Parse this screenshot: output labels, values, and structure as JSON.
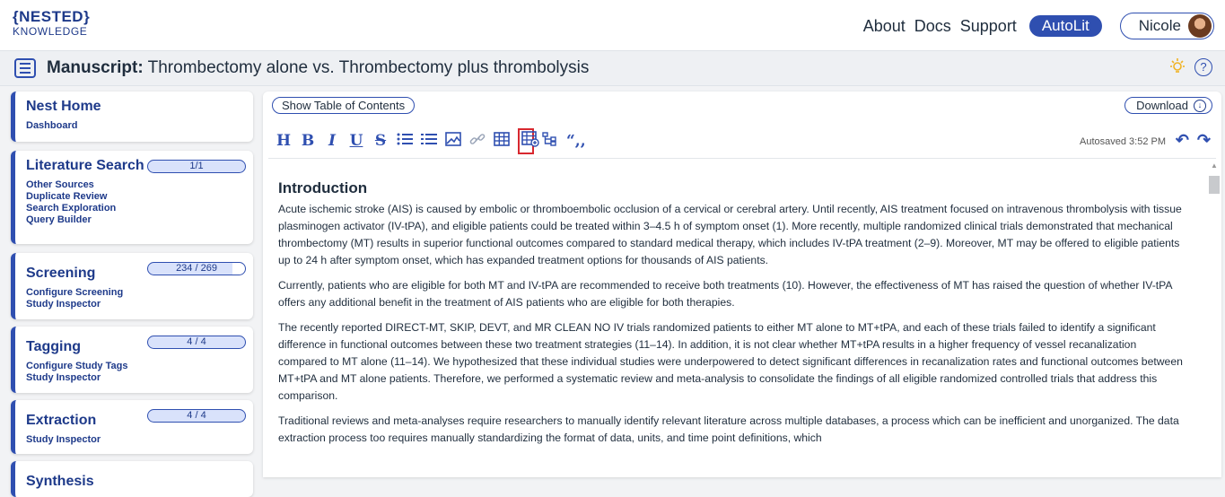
{
  "header": {
    "logo_top": "{NESTED}",
    "logo_bottom": "KNOWLEDGE",
    "nav": [
      "About",
      "Docs",
      "Support"
    ],
    "autolit_label": "AutoLit",
    "user_name": "Nicole"
  },
  "titlebar": {
    "label": "Manuscript:",
    "title": "Thrombectomy alone vs. Thrombectomy plus thrombolysis"
  },
  "sidebar": {
    "cards": [
      {
        "title": "Nest Home",
        "links": [
          "Dashboard"
        ],
        "badge": ""
      },
      {
        "title": "Literature Search",
        "links": [
          "Other Sources",
          "Duplicate Review",
          "Search Exploration",
          "Query Builder"
        ],
        "badge": "1/1"
      },
      {
        "title": "Screening",
        "links": [
          "Configure Screening",
          "Study Inspector"
        ],
        "badge": "234 / 269"
      },
      {
        "title": "Tagging",
        "links": [
          "Configure Study Tags",
          "Study Inspector"
        ],
        "badge": "4 / 4"
      },
      {
        "title": "Extraction",
        "links": [
          "Study Inspector"
        ],
        "badge": "4 / 4"
      },
      {
        "title": "Synthesis",
        "links": [],
        "badge": ""
      }
    ]
  },
  "editor": {
    "toc_label": "Show Table of Contents",
    "download_label": "Download",
    "autosave": "Autosaved 3:52 PM",
    "heading": "Introduction",
    "paragraphs": [
      "Acute ischemic stroke (AIS) is caused by embolic or thromboembolic occlusion of a cervical or cerebral artery. Until recently, AIS treatment focused on intravenous thrombolysis with tissue plasminogen activator (IV-tPA), and eligible patients could be treated within 3–4.5 h of symptom onset (1). More recently, multiple randomized clinical trials demonstrated that mechanical thrombectomy (MT) results in superior functional outcomes compared to standard medical therapy, which includes IV-tPA treatment (2–9). Moreover, MT may be offered to eligible patients up to 24 h after symptom onset, which has expanded treatment options for thousands of AIS patients.",
      "Currently, patients who are eligible for both MT and IV-tPA are recommended to receive both treatments (10). However, the effectiveness of MT has raised the question of whether IV-tPA offers any additional benefit in the treatment of AIS patients who are eligible for both therapies.",
      "The recently reported DIRECT-MT, SKIP, DEVT, and MR CLEAN NO IV trials randomized patients to either MT alone to MT+tPA, and each of these trials failed to identify a significant difference in functional outcomes between these two treatment strategies (11–14). In addition, it is not clear whether MT+tPA results in a higher frequency of vessel recanalization compared to MT alone (11–14). We hypothesized that these individual studies were underpowered to detect significant differences in recanalization rates and functional outcomes between MT+tPA and MT alone patients. Therefore, we performed a systematic review and meta-analysis to consolidate the findings of all eligible randomized controlled trials that address this comparison.",
      "Traditional reviews and meta-analyses require researchers to manually identify relevant literature across multiple databases, a process which can be inefficient and unorganized. The data extraction process too requires manually standardizing the format of data, units, and time point definitions, which"
    ]
  },
  "colors": {
    "accent": "#2f4fb0",
    "highlight_box": "#d8282f"
  }
}
